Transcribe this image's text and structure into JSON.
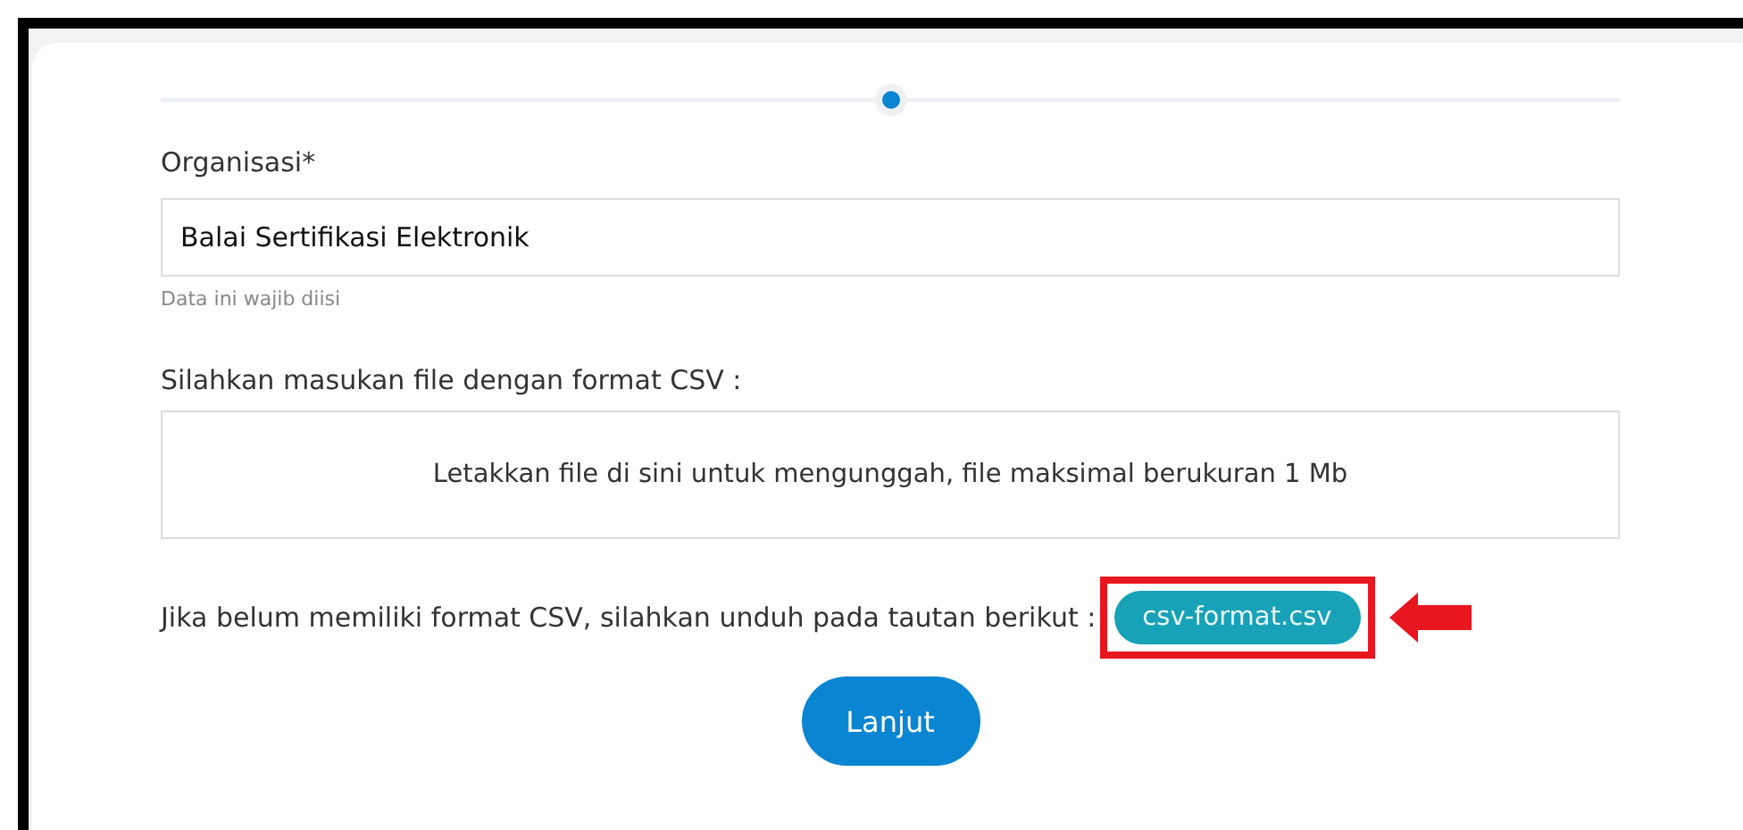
{
  "organization_field": {
    "label": "Organisasi*",
    "value": "Balai Sertifikasi Elektronik",
    "helper": "Data ini wajib diisi"
  },
  "upload": {
    "label": "Silahkan masukan file dengan format CSV :",
    "dropzone_text": "Letakkan file di sini untuk mengunggah, file maksimal berukuran 1 Mb"
  },
  "template": {
    "text": "Jika belum memiliki format CSV, silahkan unduh pada tautan berikut :",
    "link": "csv-format.csv",
    "highlighted": true
  },
  "buttons": [
    "Lanjut"
  ]
}
